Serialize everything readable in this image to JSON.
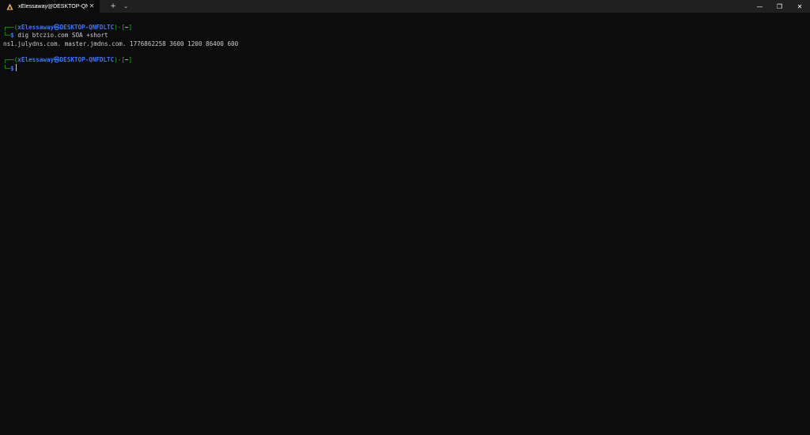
{
  "window": {
    "tab_title": "xElessaway@DESKTOP-QNFDI",
    "tab_close_glyph": "✕",
    "new_tab_glyph": "+",
    "dropdown_glyph": "⌄",
    "minimize_glyph": "—",
    "restore_glyph": "❐",
    "close_glyph": "✕"
  },
  "colors": {
    "background": "#0c0c0c",
    "titlebar": "#202020",
    "prompt_green": "#16c60c",
    "prompt_blue": "#3b78ff",
    "text": "#cccccc"
  },
  "terminal": {
    "block1": {
      "corner_top": "┌──(",
      "user_host": "xElessaway㉿DESKTOP-QNFDLTC",
      "bracket_mid": ")-[",
      "dir": "~",
      "bracket_end": "]",
      "corner_bottom": "└─",
      "dollar": "$",
      "command": "dig btczio.com SOA +short"
    },
    "output": "ns1.julydns.com. master.jmdns.com. 1776862258 3600 1200 86400 600",
    "block2": {
      "corner_top": "┌──(",
      "user_host": "xElessaway㉿DESKTOP-QNFDLTC",
      "bracket_mid": ")-[",
      "dir": "~",
      "bracket_end": "]",
      "corner_bottom": "└─",
      "dollar": "$"
    }
  }
}
